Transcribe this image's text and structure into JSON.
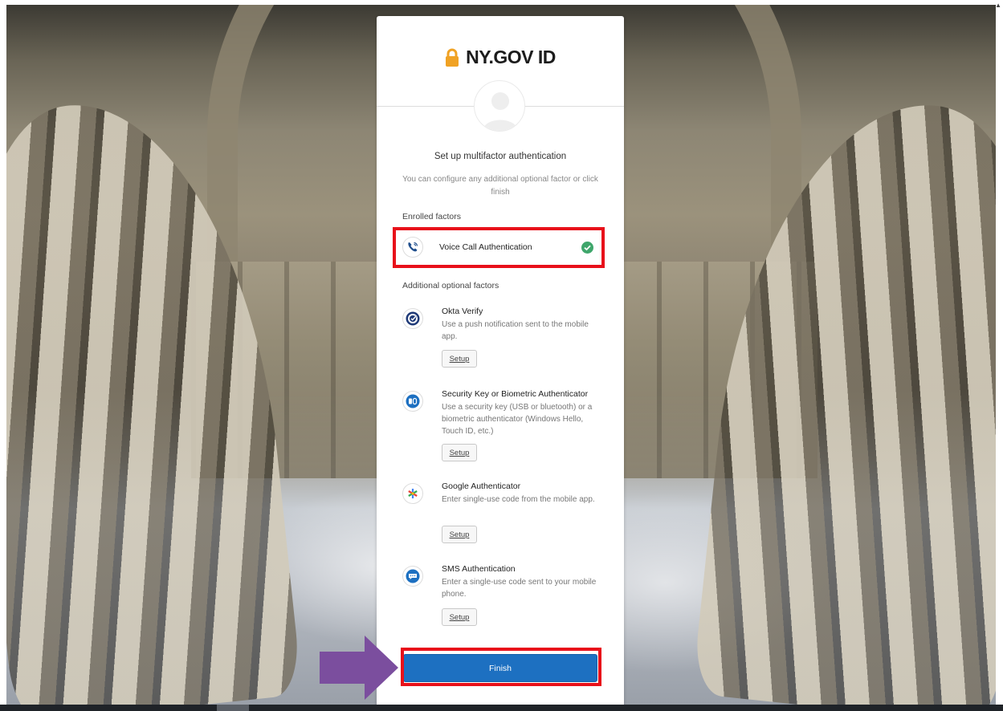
{
  "brand": {
    "logo_text": "NY.GOV ID",
    "lock_icon": "lock-icon",
    "lock_color": "#f0a224"
  },
  "header": {
    "title": "Set up multifactor authentication",
    "subtitle": "You can configure any additional optional factor or click finish"
  },
  "enrolled": {
    "label": "Enrolled factors",
    "factors": [
      {
        "name": "Voice Call Authentication",
        "icon": "voice-call-icon",
        "status_icon": "check-circle-icon",
        "status_color": "#3fa66b"
      }
    ]
  },
  "optional": {
    "label": "Additional optional factors",
    "factors": [
      {
        "name": "Okta Verify",
        "description": "Use a push notification sent to the mobile app.",
        "setup_label": "Setup",
        "icon": "okta-verify-icon"
      },
      {
        "name": "Security Key or Biometric Authenticator",
        "description": "Use a security key (USB or bluetooth) or a biometric authenticator (Windows Hello, Touch ID, etc.)",
        "setup_label": "Setup",
        "icon": "security-key-icon"
      },
      {
        "name": "Google Authenticator",
        "description": "Enter single-use code from the mobile app.",
        "setup_label": "Setup",
        "icon": "google-authenticator-icon"
      },
      {
        "name": "SMS Authentication",
        "description": "Enter a single-use code sent to your mobile phone.",
        "setup_label": "Setup",
        "icon": "sms-icon"
      }
    ]
  },
  "finish": {
    "label": "Finish",
    "color": "#1d70c1"
  },
  "annotations": {
    "highlight_color": "#e8101a",
    "arrow_color": "#7b4e9e"
  }
}
